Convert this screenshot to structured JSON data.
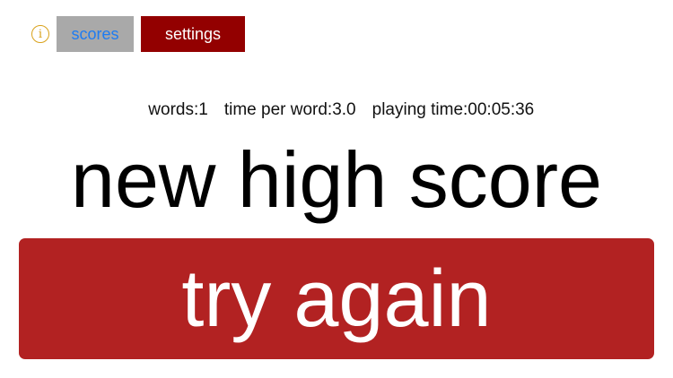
{
  "topbar": {
    "info_icon": "info-icon",
    "info_glyph": "i",
    "scores_label": "scores",
    "settings_label": "settings"
  },
  "stats": {
    "words": "words:1",
    "time_per_word": "time per word:3.0",
    "playing_time": "playing time:00:05:36"
  },
  "main": {
    "headline": "new high score",
    "try_again_label": "try again"
  },
  "colors": {
    "info_accent": "#d9a21b",
    "scores_bg": "#a9a9a9",
    "scores_text": "#1e7cf2",
    "settings_bg": "#930000",
    "try_again_bg": "#b22222"
  }
}
